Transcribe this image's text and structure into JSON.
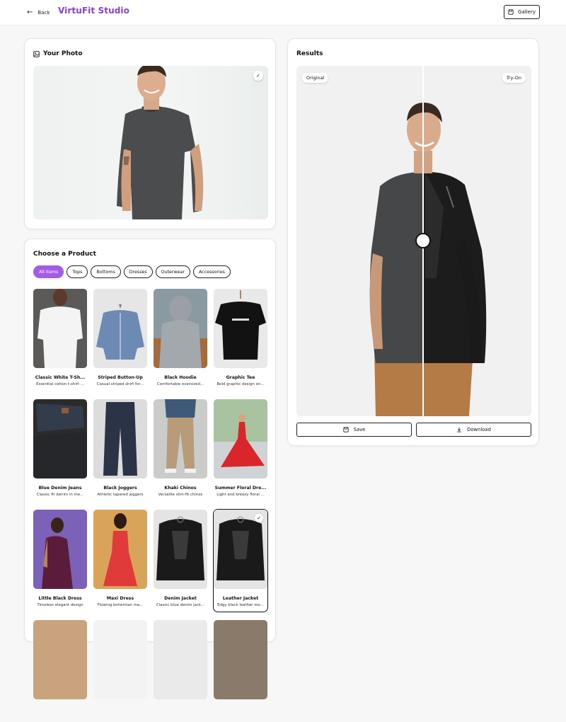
{
  "header": {
    "back_label": "Back",
    "brand": "VirtuFit Studio",
    "gallery_label": "Gallery",
    "brand_color": "#8b3fd9"
  },
  "photo": {
    "title": "Your Photo",
    "selected": true
  },
  "products": {
    "title": "Choose a Product",
    "filters": [
      "All Items",
      "Tops",
      "Bottoms",
      "Dresses",
      "Outerwear",
      "Accessories"
    ],
    "active_filter": "All Items",
    "accent_color": "#a45be8",
    "items": [
      {
        "name": "Classic White T-Sh...",
        "desc": "Essential cotton t-shirt ..."
      },
      {
        "name": "Striped Button-Up",
        "desc": "Casual striped shirt for..."
      },
      {
        "name": "Black Hoodie",
        "desc": "Comfortable oversized..."
      },
      {
        "name": "Graphic Tee",
        "desc": "Bold graphic design on..."
      },
      {
        "name": "Blue Denim Jeans",
        "desc": "Classic fit denim in me..."
      },
      {
        "name": "Black Joggers",
        "desc": "Athletic tapered joggers"
      },
      {
        "name": "Khaki Chinos",
        "desc": "Versatile slim-fit chinos"
      },
      {
        "name": "Summer Floral Dre...",
        "desc": "Light and breezy floral ..."
      },
      {
        "name": "Little Black Dress",
        "desc": "Timeless elegant design"
      },
      {
        "name": "Maxi Dress",
        "desc": "Flowing bohemian ma..."
      },
      {
        "name": "Denim Jacket",
        "desc": "Classic blue denim jack..."
      },
      {
        "name": "Leather Jacket",
        "desc": "Edgy black leather mo..."
      }
    ],
    "selected_item": "Leather Jacket"
  },
  "results": {
    "title": "Results",
    "original_tag": "Original",
    "tryon_tag": "Try-On",
    "save_label": "Save",
    "download_label": "Download"
  }
}
